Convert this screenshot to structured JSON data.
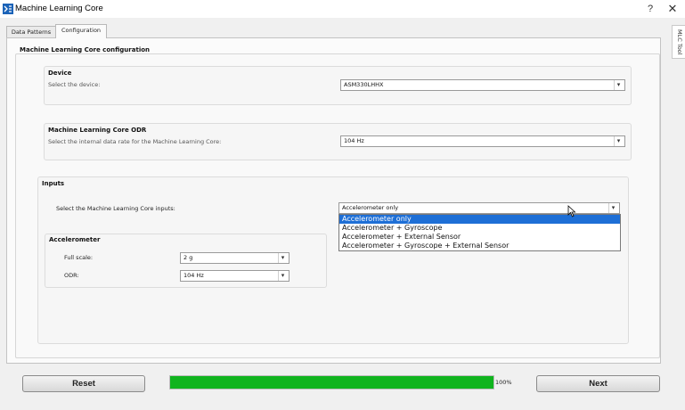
{
  "window": {
    "title": "Machine Learning Core",
    "help": "?",
    "close": "✕",
    "icon": "logo-icon"
  },
  "side_tab": {
    "label": "MLC Tool"
  },
  "tabs": [
    {
      "label": "Data Patterns",
      "active": false
    },
    {
      "label": "Configuration",
      "active": true
    }
  ],
  "panel": {
    "title": "Machine Learning Core configuration"
  },
  "device": {
    "title": "Device",
    "label": "Select the device:",
    "value": "ASM330LHHX"
  },
  "odr": {
    "title": "Machine Learning Core ODR",
    "label": "Select the internal data rate for the Machine Learning Core:",
    "value": "104 Hz"
  },
  "inputs": {
    "title": "Inputs",
    "label": "Select the Machine Learning Core inputs:",
    "value": "Accelerometer only",
    "options": [
      "Accelerometer only",
      "Accelerometer + Gyroscope",
      "Accelerometer + External Sensor",
      "Accelerometer + Gyroscope + External Sensor"
    ],
    "selected_index": 0
  },
  "accelerometer": {
    "title": "Accelerometer",
    "full_scale_label": "Full scale:",
    "full_scale_value": "2 g",
    "odr_label": "ODR:",
    "odr_value": "104 Hz"
  },
  "footer": {
    "reset": "Reset",
    "next": "Next",
    "progress": 100,
    "progress_text": "100%"
  },
  "colors": {
    "progress": "#10b41e",
    "selection": "#1e6fd6"
  }
}
